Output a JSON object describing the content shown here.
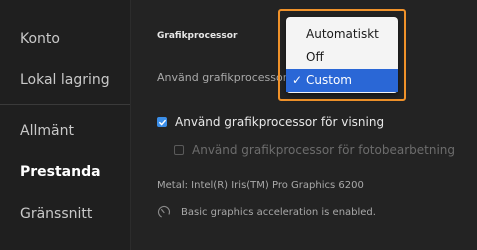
{
  "sidebar": {
    "items": [
      {
        "label": "Konto"
      },
      {
        "label": "Lokal lagring"
      },
      {
        "label": "Allmänt"
      },
      {
        "label": "Prestanda",
        "active": true
      },
      {
        "label": "Gränssnitt"
      }
    ]
  },
  "main": {
    "section_title": "Grafikprocessor",
    "gpu_label": "Använd grafikprocessor",
    "dropdown": {
      "options": [
        "Automatiskt",
        "Off",
        "Custom"
      ],
      "selected": "Custom",
      "check_mark": "✓"
    },
    "checkbox_display": {
      "label": "Använd grafikprocessor för visning",
      "checked": true
    },
    "checkbox_photo": {
      "label": "Använd grafikprocessor för fotobearbetning",
      "checked": false,
      "disabled": true
    },
    "metal_info": "Metal: Intel(R) Iris(TM) Pro Graphics 6200",
    "status_text": "Basic graphics acceleration is enabled."
  },
  "colors": {
    "accent": "#3b8ee8",
    "highlight_outline": "#f0922a",
    "menu_selected": "#2a67d6"
  },
  "icons": {
    "checkbox_check": "check-icon",
    "status": "gauge-icon"
  }
}
